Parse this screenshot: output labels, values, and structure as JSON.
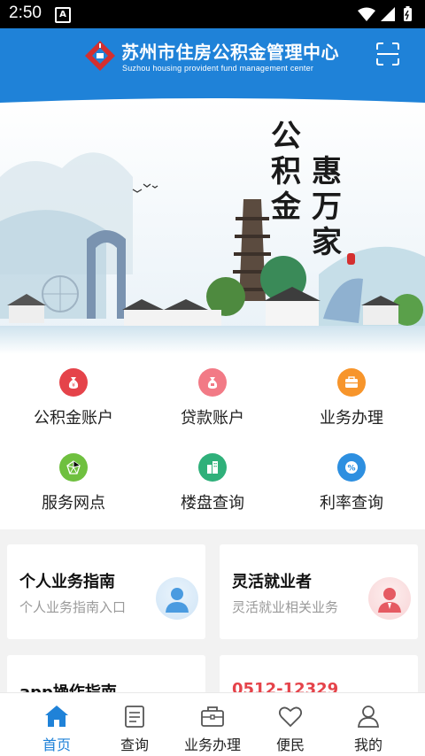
{
  "status": {
    "time": "2:50"
  },
  "header": {
    "title_cn": "苏州市住房公积金管理中心",
    "title_en": "Suzhou housing provident fund management center"
  },
  "banner": {
    "slogan_left": "公积金",
    "slogan_right": "惠万家"
  },
  "menu": {
    "items": [
      {
        "label": "公积金账户",
        "color": "#e5434a",
        "icon": "money-bag-icon"
      },
      {
        "label": "贷款账户",
        "color": "#f27a86",
        "icon": "loan-icon"
      },
      {
        "label": "业务办理",
        "color": "#f7952b",
        "icon": "briefcase-icon"
      },
      {
        "label": "服务网点",
        "color": "#6fc03f",
        "icon": "network-icon"
      },
      {
        "label": "楼盘查询",
        "color": "#2fb07a",
        "icon": "building-icon"
      },
      {
        "label": "利率查询",
        "color": "#2d8fe0",
        "icon": "percent-icon"
      }
    ]
  },
  "cards": [
    {
      "title": "个人业务指南",
      "subtitle": "个人业务指南入口"
    },
    {
      "title": "灵活就业者",
      "subtitle": "灵活就业相关业务"
    },
    {
      "title": "app操作指南",
      "subtitle": ""
    },
    {
      "title": "0512-12329",
      "subtitle": ""
    }
  ],
  "tabs": [
    {
      "label": "首页",
      "icon": "home-icon",
      "active": true
    },
    {
      "label": "查询",
      "icon": "document-icon"
    },
    {
      "label": "业务办理",
      "icon": "briefcase-icon"
    },
    {
      "label": "便民",
      "icon": "heart-icon"
    },
    {
      "label": "我的",
      "icon": "user-icon"
    }
  ],
  "colors": {
    "primary": "#1f82d8",
    "hotline": "#e5434a"
  }
}
